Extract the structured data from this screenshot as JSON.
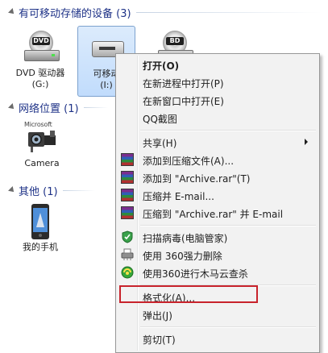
{
  "groups": {
    "removable": {
      "title": "有可移动存储的设备 (3)"
    },
    "network": {
      "title": "网络位置 (1)"
    },
    "other": {
      "title": "其他 (1)"
    }
  },
  "devices": {
    "dvd": {
      "label": "DVD 驱动器 (G:)",
      "badge": "DVD"
    },
    "removable": {
      "label_line1": "可移动",
      "label_line2": "(I:)"
    },
    "bd": {
      "badge": "BD"
    }
  },
  "network_items": {
    "camera": {
      "label": "Camera",
      "brand": "Microsoft"
    }
  },
  "other_items": {
    "phone": {
      "label": "我的手机"
    }
  },
  "context_menu": {
    "open": "打开(O)",
    "open_new_process": "在新进程中打开(P)",
    "open_new_window": "在新窗口中打开(E)",
    "qq_screenshot": "QQ截图",
    "share": "共享(H)",
    "add_to_archive": "添加到压缩文件(A)...",
    "add_to_archive_rar": "添加到 \"Archive.rar\"(T)",
    "compress_email": "压缩并 E-mail...",
    "compress_rar_email": "压缩到 \"Archive.rar\" 并 E-mail",
    "scan_virus": "扫描病毒(电脑管家)",
    "force_delete": "使用 360强力删除",
    "trojan_scan": "使用360进行木马云查杀",
    "format": "格式化(A)...",
    "eject": "弹出(J)",
    "cut": "剪切(T)"
  },
  "colors": {
    "group_title": "#1e3287",
    "highlight": "#c8232c",
    "selection": "#c1dcfc"
  }
}
